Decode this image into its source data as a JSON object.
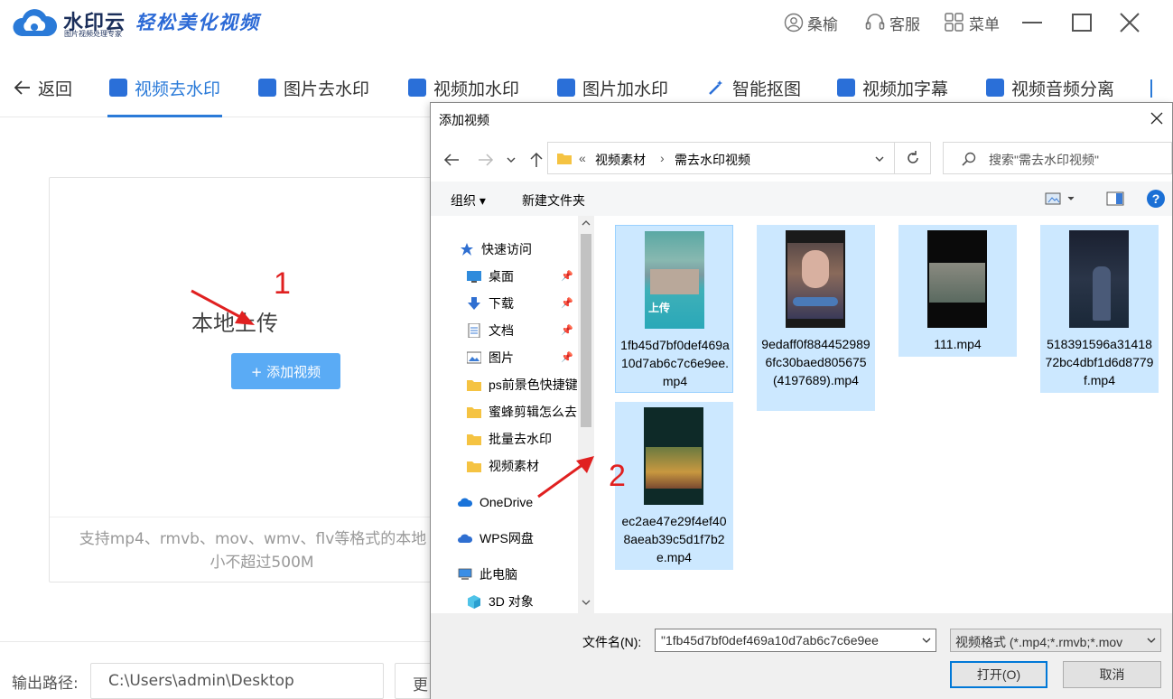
{
  "app": {
    "brand_name": "水印云",
    "brand_sub": "图片视频处理专家",
    "slogan": "轻松美化视频",
    "user_name": "桑榆",
    "service_label": "客服",
    "menu_label": "菜单"
  },
  "nav": {
    "back_label": "返回",
    "tabs": [
      {
        "label": "视频去水印",
        "active": true
      },
      {
        "label": "图片去水印"
      },
      {
        "label": "视频加水印"
      },
      {
        "label": "图片加水印"
      },
      {
        "label": "智能抠图"
      },
      {
        "label": "视频加字幕"
      },
      {
        "label": "视频音频分离"
      }
    ],
    "accent_color": "#2a7ad8"
  },
  "upload": {
    "title": "本地上传",
    "add_button": "+ 添加视频",
    "hint_line1": "支持mp4、rmvb、mov、wmv、flv等格式的本地",
    "hint_line2": "小不超过500M",
    "button_color": "#5aabf5"
  },
  "annotations": {
    "step1": "1",
    "step2": "2",
    "color": "#e02020"
  },
  "output": {
    "label": "输出路径:",
    "path": "C:\\Users\\admin\\Desktop",
    "more_label": "更改"
  },
  "dialog": {
    "title": "添加视频",
    "breadcrumb_prefix": "«",
    "breadcrumb": [
      "视频素材",
      "需去水印视频"
    ],
    "search_placeholder": "搜索\"需去水印视频\"",
    "organize_label": "组织 ▾",
    "new_folder_label": "新建文件夹",
    "nav_items": [
      {
        "label": "快速访问",
        "icon": "star-icon"
      },
      {
        "label": "桌面",
        "icon": "desktop-icon",
        "pinned": true
      },
      {
        "label": "下载",
        "icon": "download-icon",
        "pinned": true
      },
      {
        "label": "文档",
        "icon": "document-icon",
        "pinned": true
      },
      {
        "label": "图片",
        "icon": "picture-icon",
        "pinned": true
      },
      {
        "label": "ps前景色快捷键",
        "icon": "folder-icon"
      },
      {
        "label": "蜜蜂剪辑怎么去",
        "icon": "folder-icon"
      },
      {
        "label": "批量去水印",
        "icon": "folder-icon"
      },
      {
        "label": "视频素材",
        "icon": "folder-icon"
      },
      {
        "label": "OneDrive",
        "icon": "cloud-icon"
      },
      {
        "label": "WPS网盘",
        "icon": "cloud-icon"
      },
      {
        "label": "此电脑",
        "icon": "computer-icon"
      },
      {
        "label": "3D 对象",
        "icon": "cube-icon"
      }
    ],
    "files": [
      {
        "name": "1fb45d7bf0def469a10d7ab6c7c6e9ee.mp4",
        "thumb_text": "上传"
      },
      {
        "name": "9edaff0f8844529896fc30baed805675(4197689).mp4",
        "thumb_text": ""
      },
      {
        "name": "111.mp4",
        "thumb_text": ""
      },
      {
        "name": "518391596a3141872bc4dbf1d6d8779f.mp4",
        "thumb_text": ""
      },
      {
        "name": "ec2ae47e29f4ef408aeab39c5d1f7b2e.mp4",
        "thumb_text": ""
      }
    ],
    "filename_label": "文件名(N):",
    "filename_value": "\"1fb45d7bf0def469a10d7ab6c7c6e9ee",
    "filetype_value": "视频格式 (*.mp4;*.rmvb;*.mov",
    "open_label": "打开(O)",
    "cancel_label": "取消"
  }
}
